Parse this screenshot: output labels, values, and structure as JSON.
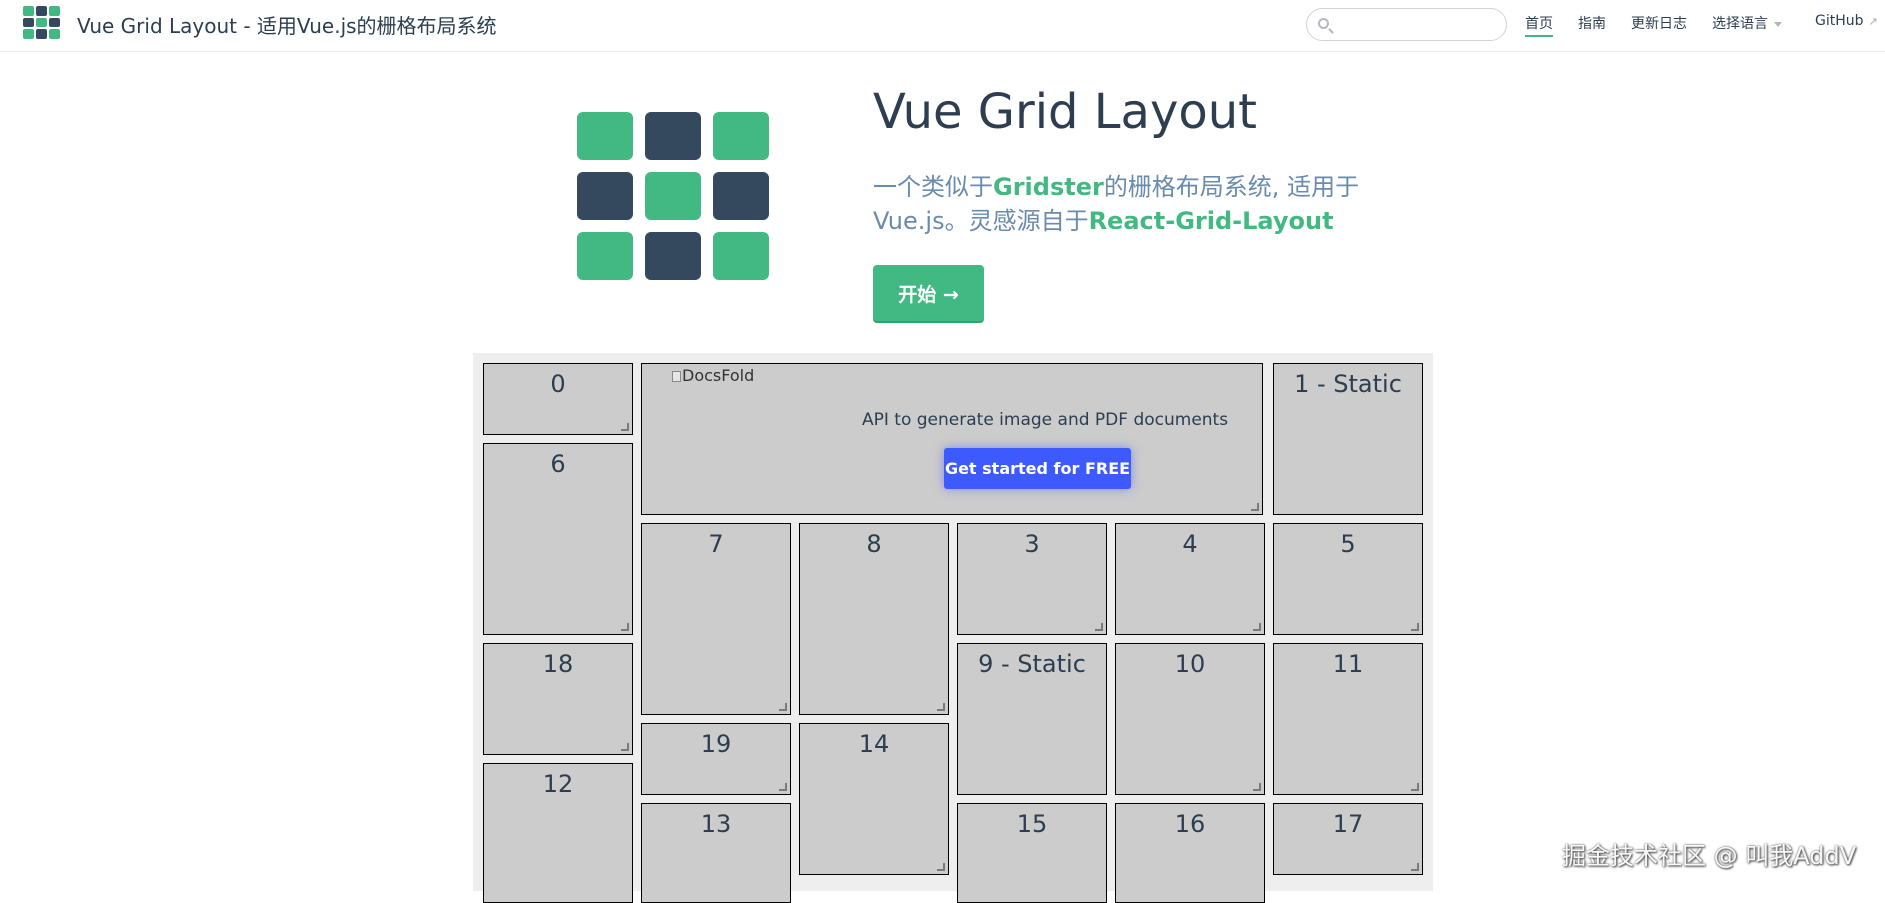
{
  "colors": {
    "green": "#42b983",
    "dark": "#34495e",
    "text": "#2c3e50",
    "desc": "#6a8bad",
    "grid_bg": "#eeeeee",
    "item_bg": "#cccccc",
    "ad_button": "#3d5afe"
  },
  "navbar": {
    "title": "Vue Grid Layout - 适用Vue.js的栅格布局系统",
    "logo_icon": "grid-logo-icon",
    "search_placeholder": "",
    "search_icon": "search-icon",
    "links": [
      {
        "label": "首页",
        "active": true
      },
      {
        "label": "指南"
      },
      {
        "label": "更新日志"
      },
      {
        "label": "选择语言"
      },
      {
        "label": "GitHub"
      }
    ]
  },
  "hero": {
    "logo_icon": "vue-grid-layout-logo",
    "title": "Vue Grid Layout",
    "desc_part1": "一个类似于",
    "desc_highlight1": "Gridster",
    "desc_part2": "的栅格布局系统, 适用于Vue.js。灵感源自于",
    "desc_highlight2": "React-Grid-Layout",
    "cta_label": "开始 →"
  },
  "grid": {
    "ad": {
      "image_alt": "DocsFold",
      "text": "API to generate image and PDF documents",
      "button_label": "Get started for FREE"
    },
    "items": {
      "i0": "0",
      "i1": "1 - Static",
      "i6": "6",
      "i7": "7",
      "i8": "8",
      "i3": "3",
      "i4": "4",
      "i5": "5",
      "i18": "18",
      "i9": "9 - Static",
      "i10": "10",
      "i11": "11",
      "i19": "19",
      "i14": "14",
      "i12": "12",
      "i13": "13",
      "i15": "15",
      "i16": "16",
      "i17": "17"
    }
  },
  "watermark": "掘金技术社区 @ 叫我AddV"
}
